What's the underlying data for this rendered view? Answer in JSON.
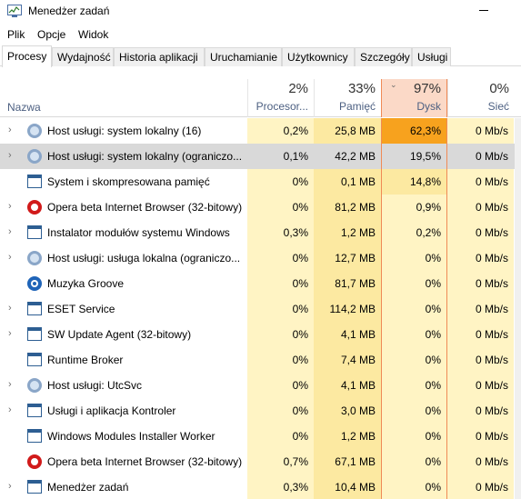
{
  "window": {
    "title": "Menedżer zadań"
  },
  "menu": [
    "Plik",
    "Opcje",
    "Widok"
  ],
  "tabs": [
    "Procesy",
    "Wydajność",
    "Historia aplikacji",
    "Uruchamianie",
    "Użytkownicy",
    "Szczegóły",
    "Usługi"
  ],
  "active_tab": "Procesy",
  "columns": {
    "name": "Nazwa",
    "cpu": {
      "percent": "2%",
      "label": "Procesor..."
    },
    "mem": {
      "percent": "33%",
      "label": "Pamięć"
    },
    "disk": {
      "percent": "97%",
      "label": "Dysk"
    },
    "net": {
      "percent": "0%",
      "label": "Sieć"
    }
  },
  "sort_arrow": "⌄",
  "heat_colors": {
    "low": "#fff4c4",
    "mid": "#fce9a1",
    "high": "#f8c36d",
    "max": "#f7a21e",
    "selected": "#d9d9d9"
  },
  "processes": [
    {
      "name": "Host usługi: system lokalny (16)",
      "icon": "gear-icon",
      "expand": true,
      "cpu": "0,2%",
      "mem": "25,8 MB",
      "disk": "62,3%",
      "net": "0 Mb/s",
      "disk_level": "max",
      "selected": false
    },
    {
      "name": "Host usługi: system lokalny (ograniczo...",
      "icon": "gear-icon",
      "expand": true,
      "cpu": "0,1%",
      "mem": "42,2 MB",
      "disk": "19,5%",
      "net": "0 Mb/s",
      "disk_level": "mid",
      "selected": true
    },
    {
      "name": "System i skompresowana pamięć",
      "icon": "box-icon",
      "expand": false,
      "cpu": "0%",
      "mem": "0,1 MB",
      "disk": "14,8%",
      "net": "0 Mb/s",
      "disk_level": "mid",
      "selected": false
    },
    {
      "name": "Opera beta Internet Browser (32-bitowy)",
      "icon": "opera-icon",
      "expand": true,
      "cpu": "0%",
      "mem": "81,2 MB",
      "disk": "0,9%",
      "net": "0 Mb/s",
      "disk_level": "low",
      "selected": false
    },
    {
      "name": "Instalator modułów systemu Windows",
      "icon": "box-icon",
      "expand": true,
      "cpu": "0,3%",
      "mem": "1,2 MB",
      "disk": "0,2%",
      "net": "0 Mb/s",
      "disk_level": "low",
      "selected": false
    },
    {
      "name": "Host usługi: usługa lokalna (ograniczo...",
      "icon": "gear-icon",
      "expand": true,
      "cpu": "0%",
      "mem": "12,7 MB",
      "disk": "0%",
      "net": "0 Mb/s",
      "disk_level": "low",
      "selected": false
    },
    {
      "name": "Muzyka Groove",
      "icon": "groove-icon",
      "expand": false,
      "cpu": "0%",
      "mem": "81,7 MB",
      "disk": "0%",
      "net": "0 Mb/s",
      "disk_level": "low",
      "selected": false
    },
    {
      "name": "ESET Service",
      "icon": "box-icon",
      "expand": true,
      "cpu": "0%",
      "mem": "114,2 MB",
      "disk": "0%",
      "net": "0 Mb/s",
      "disk_level": "low",
      "selected": false
    },
    {
      "name": "SW Update Agent (32-bitowy)",
      "icon": "box-icon",
      "expand": true,
      "cpu": "0%",
      "mem": "4,1 MB",
      "disk": "0%",
      "net": "0 Mb/s",
      "disk_level": "low",
      "selected": false
    },
    {
      "name": "Runtime Broker",
      "icon": "box-icon",
      "expand": false,
      "cpu": "0%",
      "mem": "7,4 MB",
      "disk": "0%",
      "net": "0 Mb/s",
      "disk_level": "low",
      "selected": false
    },
    {
      "name": "Host usługi: UtcSvc",
      "icon": "gear-icon",
      "expand": true,
      "cpu": "0%",
      "mem": "4,1 MB",
      "disk": "0%",
      "net": "0 Mb/s",
      "disk_level": "low",
      "selected": false
    },
    {
      "name": "Usługi i aplikacja Kontroler",
      "icon": "box-icon",
      "expand": true,
      "cpu": "0%",
      "mem": "3,0 MB",
      "disk": "0%",
      "net": "0 Mb/s",
      "disk_level": "low",
      "selected": false
    },
    {
      "name": "Windows Modules Installer Worker",
      "icon": "box-icon",
      "expand": false,
      "cpu": "0%",
      "mem": "1,2 MB",
      "disk": "0%",
      "net": "0 Mb/s",
      "disk_level": "low",
      "selected": false
    },
    {
      "name": "Opera beta Internet Browser (32-bitowy)",
      "icon": "opera-icon",
      "expand": false,
      "cpu": "0,7%",
      "mem": "67,1 MB",
      "disk": "0%",
      "net": "0 Mb/s",
      "disk_level": "low",
      "selected": false
    },
    {
      "name": "Menedżer zadań",
      "icon": "box-icon",
      "expand": true,
      "cpu": "0,3%",
      "mem": "10,4 MB",
      "disk": "0%",
      "net": "0 Mb/s",
      "disk_level": "low",
      "selected": false
    }
  ]
}
